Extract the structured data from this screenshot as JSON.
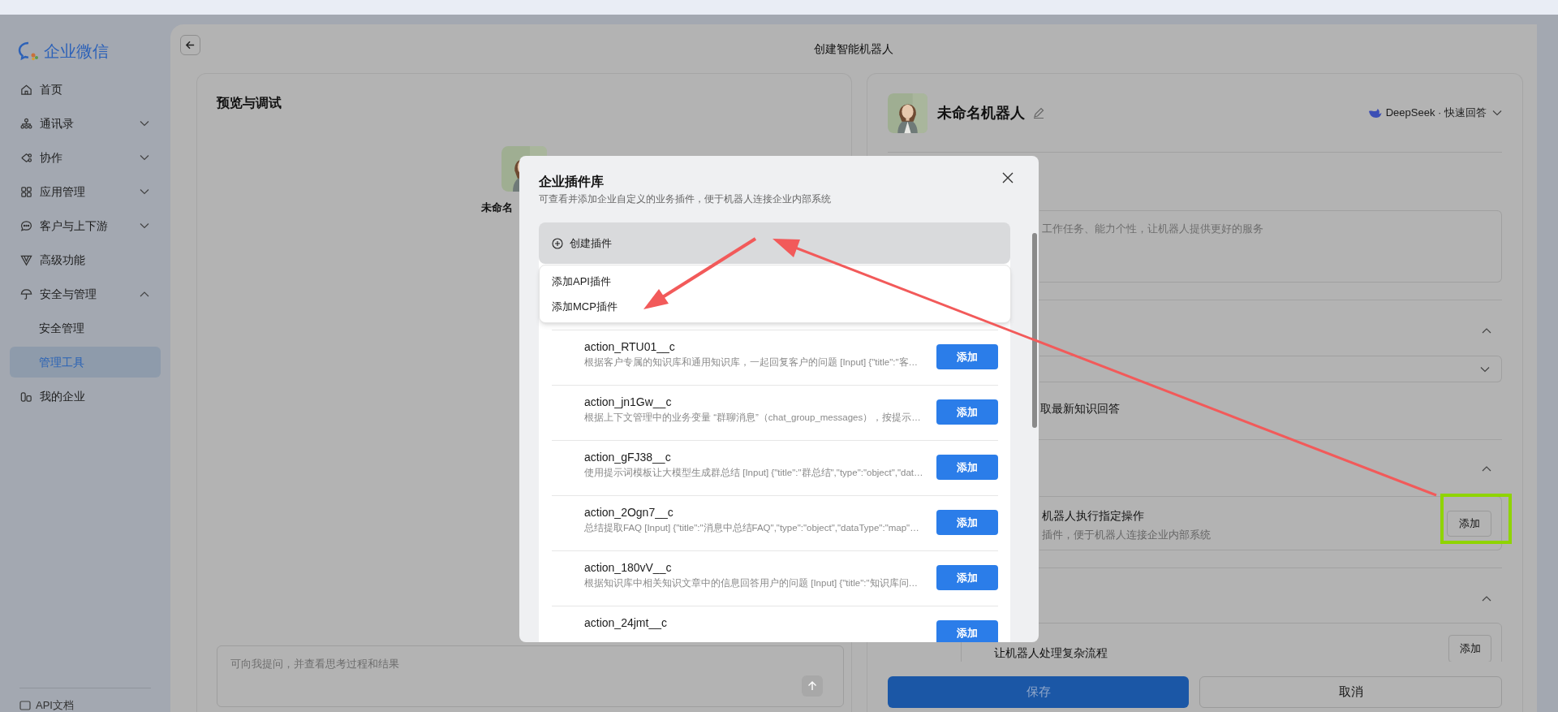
{
  "sidebar": {
    "logo": "企业微信",
    "items": [
      {
        "label": "首页",
        "selected": false
      },
      {
        "label": "通讯录",
        "selected": false,
        "expanded": false
      },
      {
        "label": "协作",
        "selected": false,
        "expanded": false
      },
      {
        "label": "应用管理",
        "selected": false,
        "expanded": false
      },
      {
        "label": "客户与上下游",
        "selected": false,
        "expanded": false
      },
      {
        "label": "高级功能",
        "selected": false
      },
      {
        "label": "安全与管理",
        "selected": false,
        "expanded": true,
        "children": [
          {
            "label": "安全管理",
            "selected": false
          },
          {
            "label": "管理工具",
            "selected": true
          }
        ]
      },
      {
        "label": "我的企业",
        "selected": false
      }
    ],
    "footer": "API文档"
  },
  "header": {
    "title": "创建智能机器人"
  },
  "preview": {
    "title": "预览与调试",
    "bot_name": "未命名",
    "input_placeholder": "可向我提问，并查看思考过程和结果"
  },
  "config": {
    "bot_name": "未命名机器人",
    "model": "DeepSeek · 快速回答",
    "prompt_placeholder": "工作任务、能力个性，让机器人提供更好的服务",
    "knowledge_option": "取最新知识回答",
    "plugin_card": {
      "title": "机器人执行指定操作",
      "description": "插件，便于机器人连接企业内部系统",
      "button": "添加"
    },
    "workflow_card": {
      "title": "让机器人处理复杂流程",
      "button": "添加"
    },
    "save": "保存",
    "cancel": "取消"
  },
  "modal": {
    "title": "企业插件库",
    "subtitle": "可查看并添加企业自定义的业务插件，便于机器人连接企业内部系统",
    "create_button": "创建插件",
    "menu": [
      "添加API插件",
      "添加MCP插件"
    ],
    "plugins": [
      {
        "name": "action_RTU01__c",
        "description": "根据客户专属的知识库和通用知识库，一起回复客户的问题 [Input] {\"title\":\"客…",
        "button": "添加"
      },
      {
        "name": "action_jn1Gw__c",
        "description": "根据上下文管理中的业务变量 “群聊消息”（chat_group_messages），按提示…",
        "button": "添加"
      },
      {
        "name": "action_gFJ38__c",
        "description": "使用提示词模板让大模型生成群总结 [Input] {\"title\":\"群总结\",\"type\":\"object\",\"dat…",
        "button": "添加"
      },
      {
        "name": "action_2Ogn7__c",
        "description": "总结提取FAQ [Input] {\"title\":\"消息中总结FAQ\",\"type\":\"object\",\"dataType\":\"map\"…",
        "button": "添加"
      },
      {
        "name": "action_180vV__c",
        "description": "根据知识库中相关知识文章中的信息回答用户的问题 [Input] {\"title\":\"知识库问…",
        "button": "添加"
      },
      {
        "name": "action_24jmt__c",
        "button": "添加"
      }
    ]
  }
}
